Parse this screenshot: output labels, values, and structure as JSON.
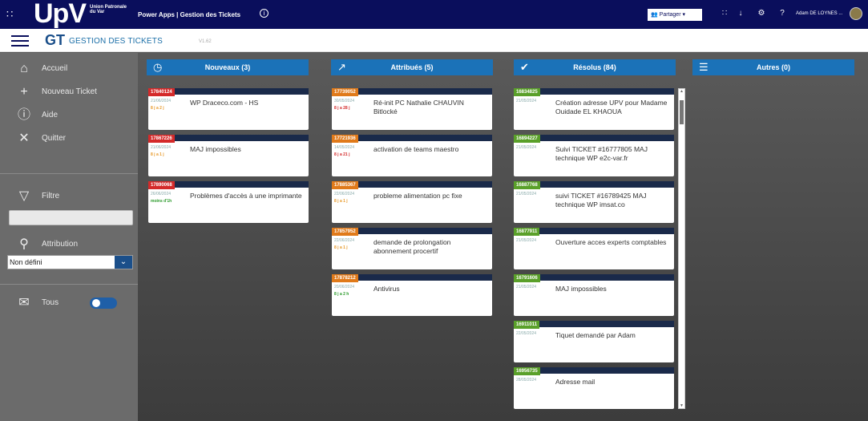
{
  "topbar": {
    "logo_text": "UpV",
    "logo_sub": "Union Patronale du Var",
    "app_title": "Power Apps | Gestion des Tickets",
    "share_label": "Partager",
    "user_name": "Adam DE LOYNES ..."
  },
  "header": {
    "abbr": "GT",
    "title": "GESTION DES TICKETS",
    "version": "V1.62"
  },
  "sidebar": {
    "items": [
      {
        "label": "Accueil",
        "icon": "home-icon"
      },
      {
        "label": "Nouveau Ticket",
        "icon": "plus-icon"
      },
      {
        "label": "Aide",
        "icon": "help-icon"
      },
      {
        "label": "Quitter",
        "icon": "close-icon"
      }
    ],
    "filter_label": "Filtre",
    "attribution_label": "Attribution",
    "attribution_value": "Non défini",
    "tous_label": "Tous"
  },
  "columns": [
    {
      "label": "Nouveaux (3)",
      "icon": "clock-icon"
    },
    {
      "label": "Attribués (5)",
      "icon": "assign-icon"
    },
    {
      "label": "Résolus (84)",
      "icon": "check-circle-icon"
    },
    {
      "label": "Autres (0)",
      "icon": "list-icon"
    }
  ],
  "cards": {
    "nouveaux": [
      {
        "id": "17840124",
        "date": "21/06/2024",
        "age": "8 j a 2 j",
        "title": "WP Draceco.com - HS",
        "tag_color": "#d42a2a",
        "age_color": "#e89a2a"
      },
      {
        "id": "17867226",
        "date": "21/06/2024",
        "age": "8 j a 1 j",
        "title": "MAJ impossibles",
        "tag_color": "#d42a2a",
        "age_color": "#e89a2a"
      },
      {
        "id": "17890068",
        "date": "26/06/2024",
        "age": "moins d'1h",
        "title": "Problèmes d'accès à une imprimante",
        "tag_color": "#d42a2a",
        "age_color": "#2a9a2a"
      }
    ],
    "attribues": [
      {
        "id": "17739052",
        "date": "30/05/2024",
        "age": "8 j a 28 j",
        "title": "Ré-init PC Nathalie CHAUVIN Bitlocké",
        "tag_color": "#e07a1a",
        "age_color": "#d42a2a"
      },
      {
        "id": "17721936",
        "date": "14/05/2024",
        "age": "8 j a 21 j",
        "title": "activation de teams maestro",
        "tag_color": "#e07a1a",
        "age_color": "#d42a2a"
      },
      {
        "id": "17885367",
        "date": "22/06/2024",
        "age": "8 j a 1 j",
        "title": "probleme alimentation pc fixe",
        "tag_color": "#e07a1a",
        "age_color": "#e89a2a"
      },
      {
        "id": "17857952",
        "date": "22/06/2024",
        "age": "8 j a 1 j",
        "title": "demande de prolongation abonnement procertif",
        "tag_color": "#e07a1a",
        "age_color": "#e89a2a"
      },
      {
        "id": "17878212",
        "date": "20/06/2024",
        "age": "8 j a 2 h",
        "title": "Antivirus",
        "tag_color": "#e07a1a",
        "age_color": "#2a9a2a"
      }
    ],
    "resolus": [
      {
        "id": "16834825",
        "date": "21/05/2024",
        "title": "Création adresse UPV pour Madame Ouidade EL KHAOUA",
        "tag_color": "#5aa02a"
      },
      {
        "id": "16894227",
        "date": "21/05/2024",
        "title": "Suivi TICKET #16777805 MAJ technique WP e2c-var.fr",
        "tag_color": "#5aa02a"
      },
      {
        "id": "16887768",
        "date": "21/05/2024",
        "title": "suivi TICKET #16789425 MAJ technique WP imsat.co",
        "tag_color": "#5aa02a"
      },
      {
        "id": "16877911",
        "date": "21/05/2024",
        "title": "Ouverture acces experts comptables",
        "tag_color": "#5aa02a"
      },
      {
        "id": "16791606",
        "date": "21/05/2024",
        "title": "MAJ impossibles",
        "tag_color": "#5aa02a"
      },
      {
        "id": "16911011",
        "date": "22/05/2024",
        "title": "Tiquet demandé par Adam",
        "tag_color": "#5aa02a"
      },
      {
        "id": "16956735",
        "date": "28/05/2024",
        "title": "Adresse mail",
        "tag_color": "#5aa02a"
      }
    ]
  }
}
